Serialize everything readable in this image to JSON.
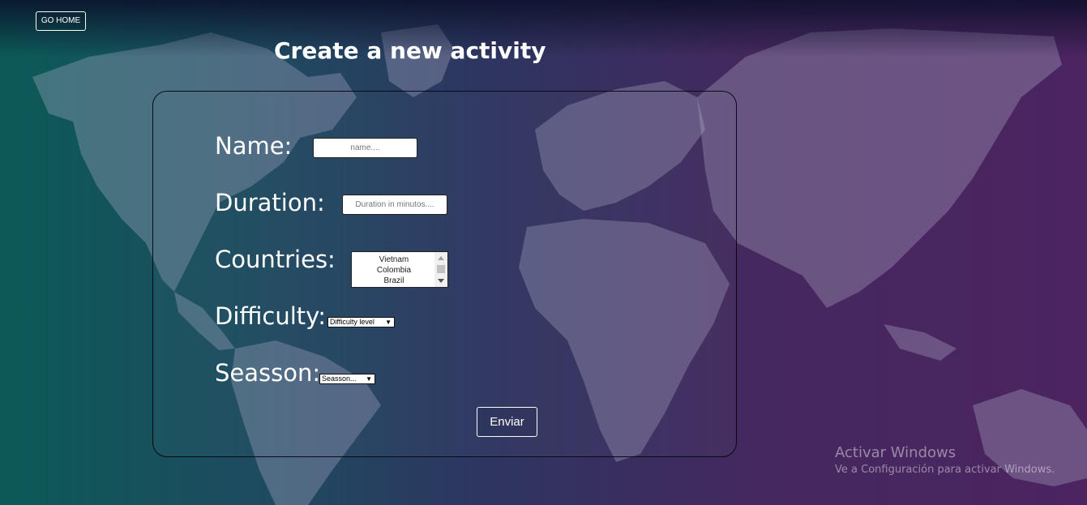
{
  "nav": {
    "go_home_label": "GO HOME"
  },
  "page": {
    "title": "Create a new activity"
  },
  "form": {
    "name": {
      "label": "Name:",
      "placeholder": "name....",
      "value": ""
    },
    "duration": {
      "label": "Duration:",
      "placeholder": "Duration in minutos....",
      "value": ""
    },
    "countries": {
      "label": "Countries:",
      "options": [
        "Vietnam",
        "Colombia",
        "Brazil"
      ]
    },
    "difficulty": {
      "label": "Difficulty:",
      "selected": "Difficulty level"
    },
    "season": {
      "label": "Seasson:",
      "selected": "Seasson..."
    },
    "submit_label": "Enviar"
  },
  "watermark": {
    "title": "Activar Windows",
    "subtitle": "Ve a Configuración para activar Windows."
  },
  "colors": {
    "background_left": "#0b5a57",
    "background_right": "#4b2460",
    "map_fill": "#b6b3cf",
    "text": "#ffffff"
  },
  "icons": [
    "chevron-down-icon",
    "scroll-up-icon",
    "scroll-down-icon"
  ]
}
